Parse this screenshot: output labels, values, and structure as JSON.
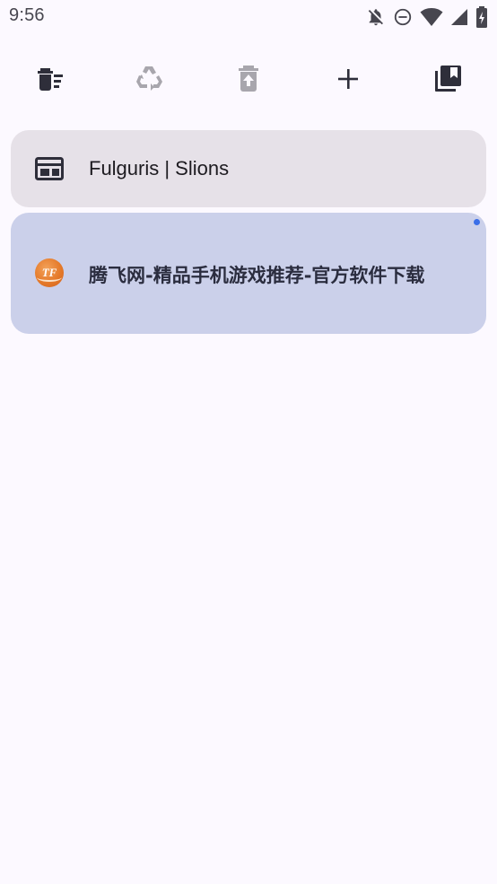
{
  "status_bar": {
    "time": "9:56",
    "icons": [
      "notifications-off-icon",
      "do-not-disturb-icon",
      "wifi-icon",
      "signal-icon",
      "battery-charging-icon"
    ]
  },
  "toolbar": {
    "buttons": [
      {
        "name": "close-all-tabs-button",
        "icon": "clear-all-icon"
      },
      {
        "name": "recycle-button",
        "icon": "recycle-icon"
      },
      {
        "name": "restore-closed-tab-button",
        "icon": "restore-from-trash-icon"
      },
      {
        "name": "new-tab-button",
        "icon": "plus-icon"
      },
      {
        "name": "bookmarks-button",
        "icon": "library-bookmarks-icon"
      }
    ]
  },
  "tabs": [
    {
      "title": "Fulguris | Slions",
      "active": false,
      "favicon": "web-page-icon"
    },
    {
      "title": "腾飞网-精品手机游戏推荐-官方软件下载",
      "active": true,
      "favicon": "tf-logo-icon",
      "logo_text": "TF"
    }
  ],
  "colors": {
    "background": "#fcf9ff",
    "inactive_tab": "#e6e1e8",
    "active_tab": "#cbd0ea",
    "active_indicator": "#3a6ee8",
    "icon": "#2e2e3a",
    "icon_disabled": "#a8a6ad"
  }
}
